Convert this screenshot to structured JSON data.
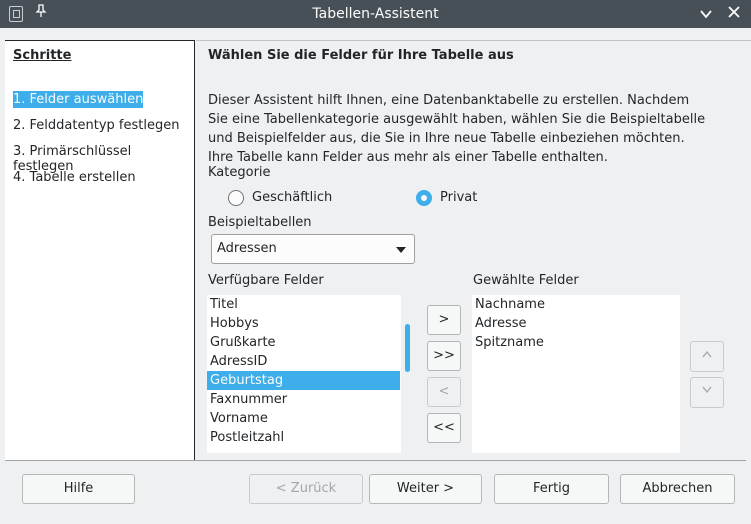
{
  "window": {
    "title": "Tabellen-Assistent"
  },
  "steps": {
    "title": "Schritte",
    "items": [
      "1. Felder auswählen",
      "2. Felddatentyp festlegen",
      "3. Primärschlüssel festlegen",
      "4. Tabelle erstellen"
    ]
  },
  "main": {
    "heading": "Wählen Sie die Felder für Ihre Tabelle aus",
    "description": "Dieser Assistent hilft Ihnen, eine Datenbanktabelle zu erstellen. Nachdem Sie eine Tabellenkategorie ausgewählt haben, wählen Sie die Beispieltabelle und Beispielfelder aus, die Sie in Ihre neue Tabelle einbeziehen möchten. Ihre Tabelle kann Felder aus mehr als einer Tabelle enthalten.",
    "category_label": "Kategorie",
    "category_options": [
      "Geschäftlich",
      "Privat"
    ],
    "category_selected": "Privat",
    "sample_tables_label": "Beispieltabellen",
    "sample_table_value": "Adressen",
    "available_label": "Verfügbare Felder",
    "available_fields": [
      "Titel",
      "Hobbys",
      "Grußkarte",
      "AdressID",
      "Geburtstag",
      "Faxnummer",
      "Vorname",
      "Postleitzahl"
    ],
    "available_selected": "Geburtstag",
    "chosen_label": "Gewählte Felder",
    "chosen_fields": [
      "Nachname",
      "Adresse",
      "Spitzname"
    ],
    "transfer_buttons": [
      ">",
      ">>",
      "<",
      "<<"
    ],
    "order_buttons": [
      "^",
      "v"
    ]
  },
  "buttons": {
    "help": "Hilfe",
    "back": "< Zurück",
    "next": "Weiter >",
    "finish": "Fertig",
    "cancel": "Abbrechen"
  },
  "icons": {
    "app": "document-icon",
    "pin": "pin-icon",
    "minimize": "chevron-down-icon",
    "close": "close-icon"
  },
  "colors": {
    "titlebar": "#475057",
    "accent": "#3daee9",
    "window": "#eff0f1"
  }
}
